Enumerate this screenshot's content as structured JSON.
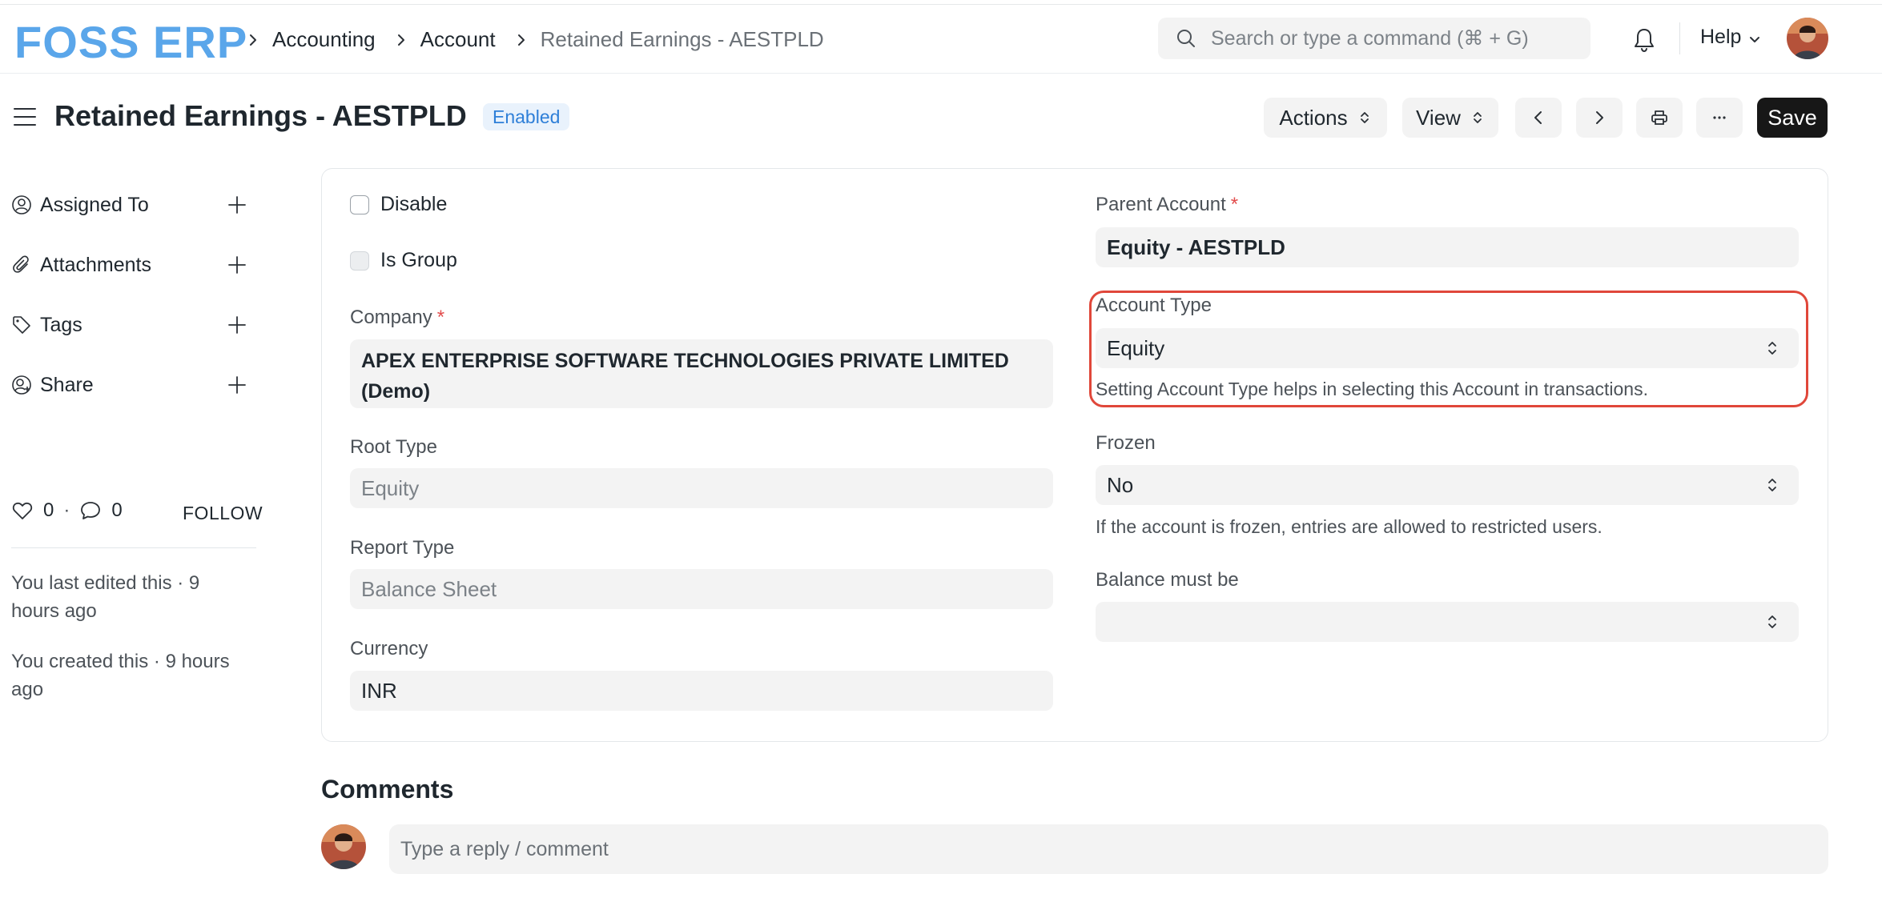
{
  "navbar": {
    "brand": "FOSS ERP",
    "breadcrumbs": [
      "Accounting",
      "Account",
      "Retained Earnings - AESTPLD"
    ],
    "search_placeholder": "Search or type a command (⌘ + G)",
    "help_label": "Help"
  },
  "page": {
    "title": "Retained Earnings - AESTPLD",
    "status": "Enabled",
    "status_color": "#2e7fd8"
  },
  "toolbar": {
    "actions_label": "Actions",
    "view_label": "View",
    "save_label": "Save",
    "save_color": "#171717"
  },
  "sidebar": {
    "items": [
      {
        "label": "Assigned To",
        "icon": "user-icon"
      },
      {
        "label": "Attachments",
        "icon": "paperclip-icon"
      },
      {
        "label": "Tags",
        "icon": "tag-icon"
      },
      {
        "label": "Share",
        "icon": "share-icon"
      }
    ],
    "likes": "0",
    "comments": "0",
    "follow_label": "FOLLOW",
    "last_edited": "You last edited this · 9 hours ago",
    "created": "You created this · 9 hours ago"
  },
  "form": {
    "disable_label": "Disable",
    "disable_checked": false,
    "is_group_label": "Is Group",
    "is_group_checked": false,
    "company_label": "Company",
    "company_value": "APEX ENTERPRISE SOFTWARE TECHNOLOGIES PRIVATE LIMITED (Demo)",
    "root_type_label": "Root Type",
    "root_type_value": "Equity",
    "report_type_label": "Report Type",
    "report_type_value": "Balance Sheet",
    "currency_label": "Currency",
    "currency_value": "INR",
    "parent_account_label": "Parent Account",
    "parent_account_value": "Equity - AESTPLD",
    "account_type_label": "Account Type",
    "account_type_value": "Equity",
    "account_type_help": "Setting Account Type helps in selecting this Account in transactions.",
    "frozen_label": "Frozen",
    "frozen_value": "No",
    "frozen_help": "If the account is frozen, entries are allowed to restricted users.",
    "balance_label": "Balance must be",
    "balance_value": "",
    "required_mark": "*",
    "highlight_color": "#e0473a"
  },
  "comments": {
    "title": "Comments",
    "placeholder": "Type a reply / comment"
  }
}
